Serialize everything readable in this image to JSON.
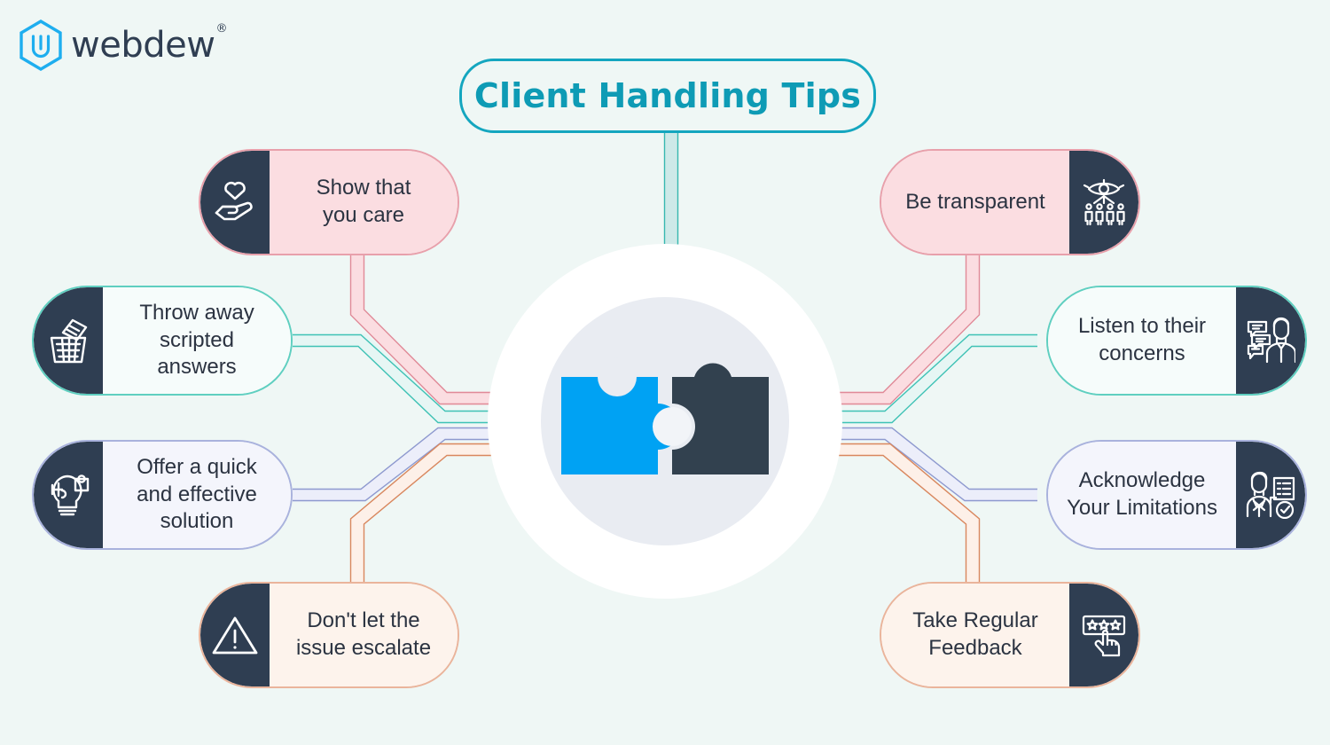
{
  "background_color": "#eff7f5",
  "brand": {
    "name": "webdew",
    "trademark": "®",
    "mark_icon": "hexagon-w-logo-icon",
    "mark_color": "#1eaeef",
    "word_color": "#2f3e52"
  },
  "title": {
    "text": "Client Handling Tips",
    "color": "#0e9bb5",
    "border_color": "#14a6bf"
  },
  "hub": {
    "icon": "two-puzzle-pieces-icon",
    "outer_ring_color": "#ffffff",
    "inner_circle_color": "#e9ecf2",
    "piece_left_color": "#00a2f3",
    "piece_right_color": "#32414f"
  },
  "palettes": {
    "pink": {
      "border": "#e8a0ab",
      "fill": "#fbdde1"
    },
    "teal": {
      "border": "#5fcfc0",
      "fill": "#f6fcfb"
    },
    "lavender": {
      "border": "#a9b2dd",
      "fill": "#f4f5fc"
    },
    "peach": {
      "border": "#eab49b",
      "fill": "#fdf3ec"
    },
    "icon_panel": "#2f3e52",
    "icon_stroke": "#ffffff"
  },
  "nodes": {
    "left": [
      {
        "id": "show-that-you-care",
        "label": "Show that\nyou care",
        "icon": "hand-holding-heart-icon",
        "palette": "pink"
      },
      {
        "id": "throw-away-scripted",
        "label": "Throw away\nscripted\nanswers",
        "icon": "trash-paper-icon",
        "palette": "teal"
      },
      {
        "id": "offer-quick-solution",
        "label": "Offer a quick\nand effective\nsolution",
        "icon": "lightbulb-puzzle-icon",
        "palette": "lavender"
      },
      {
        "id": "dont-let-issue-escalate",
        "label": "Don't let the\nissue escalate",
        "icon": "warning-triangle-icon",
        "palette": "peach"
      }
    ],
    "right": [
      {
        "id": "be-transparent",
        "label": "Be transparent",
        "icon": "eye-over-people-icon",
        "palette": "pink"
      },
      {
        "id": "listen-to-their-concerns",
        "label": "Listen to their\nconcerns",
        "icon": "person-speech-bubbles-icon",
        "palette": "teal"
      },
      {
        "id": "acknowledge-limitations",
        "label": "Acknowledge\nYour Limitations",
        "icon": "person-checklist-icon",
        "palette": "lavender"
      },
      {
        "id": "take-regular-feedback",
        "label": "Take Regular\nFeedback",
        "icon": "star-rating-hand-icon",
        "palette": "peach"
      }
    ]
  }
}
